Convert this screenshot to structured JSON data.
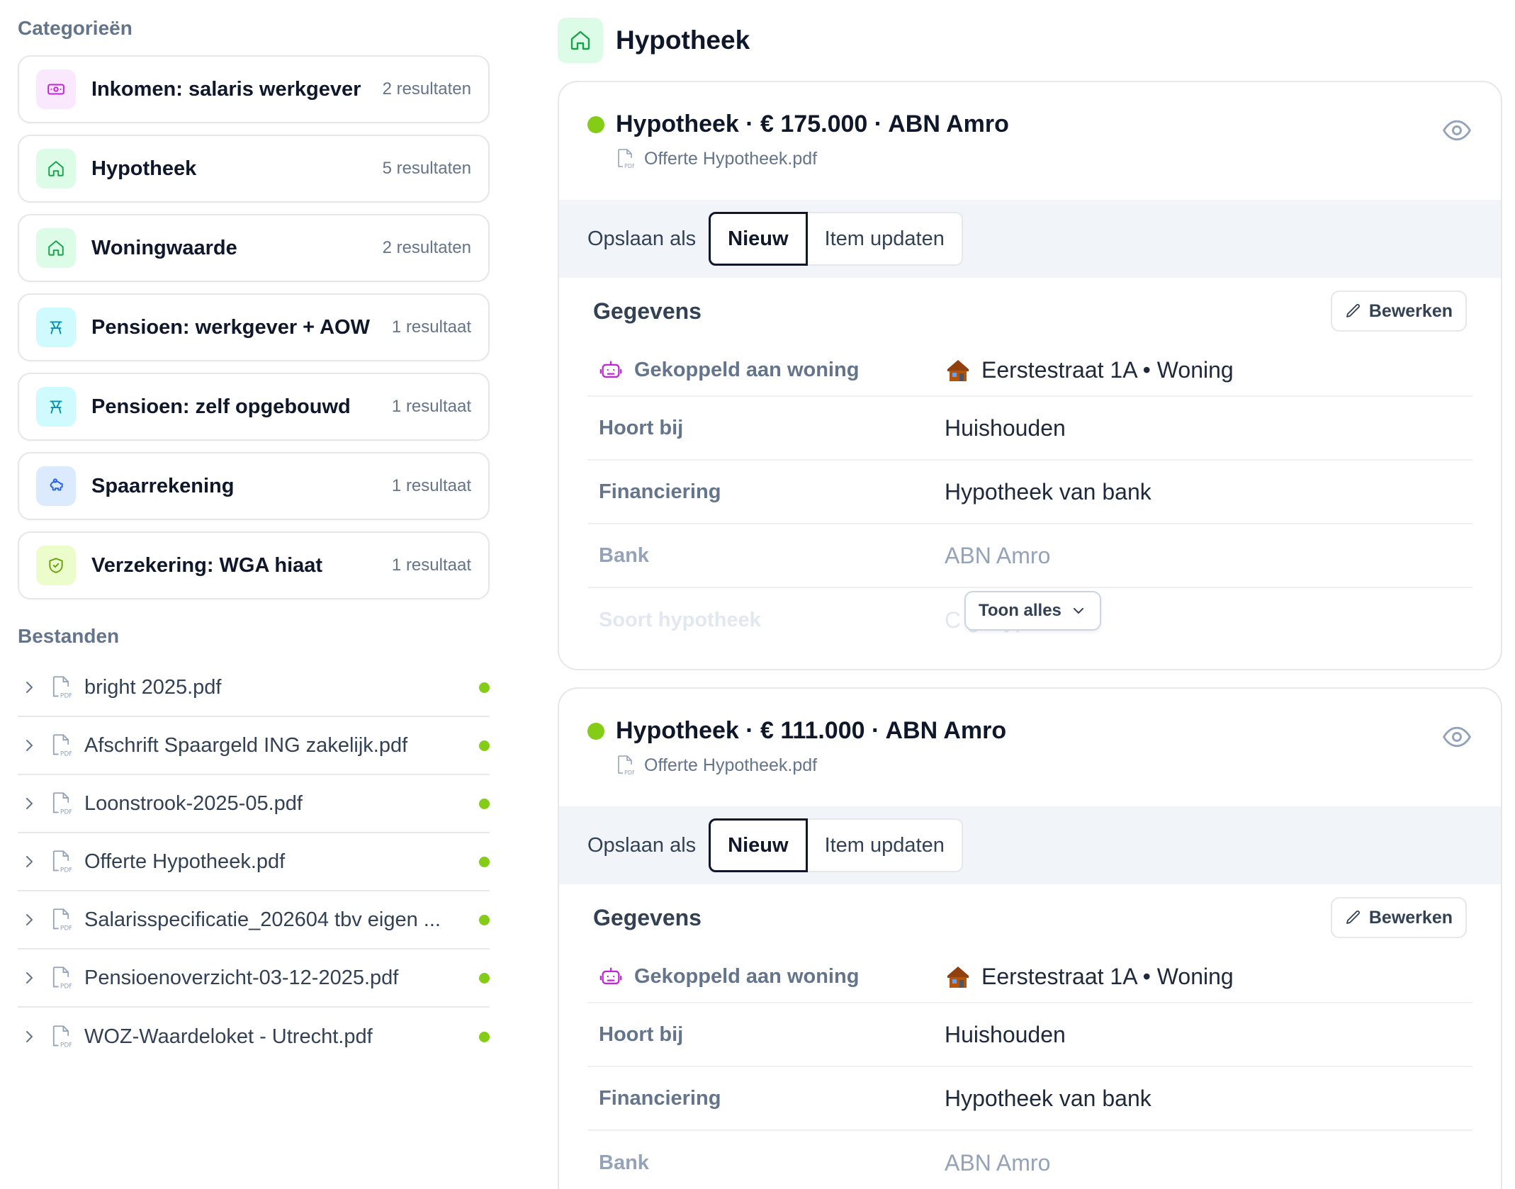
{
  "sidebar": {
    "categories_title": "Categorieën",
    "categories": [
      {
        "name": "Inkomen: salaris werkgever",
        "count": "2 resultaten",
        "icon": "banknote-icon",
        "bg": "#fae8ff",
        "fg": "#c026d3"
      },
      {
        "name": "Hypotheek",
        "count": "5 resultaten",
        "icon": "home-icon",
        "bg": "#dcfce7",
        "fg": "#16a34a"
      },
      {
        "name": "Woningwaarde",
        "count": "2 resultaten",
        "icon": "home-icon",
        "bg": "#dcfce7",
        "fg": "#16a34a"
      },
      {
        "name": "Pensioen: werkgever + AOW",
        "count": "1 resultaat",
        "icon": "beach-chair-icon",
        "bg": "#cffafe",
        "fg": "#0891b2"
      },
      {
        "name": "Pensioen: zelf opgebouwd",
        "count": "1 resultaat",
        "icon": "beach-chair-icon",
        "bg": "#cffafe",
        "fg": "#0891b2"
      },
      {
        "name": "Spaarrekening",
        "count": "1 resultaat",
        "icon": "piggy-bank-icon",
        "bg": "#dbeafe",
        "fg": "#2563eb"
      },
      {
        "name": "Verzekering: WGA hiaat",
        "count": "1 resultaat",
        "icon": "shield-check-icon",
        "bg": "#ecfccb",
        "fg": "#65a30d"
      }
    ],
    "files_title": "Bestanden",
    "files": [
      "bright 2025.pdf",
      "Afschrift Spaargeld ING zakelijk.pdf",
      "Loonstrook-2025-05.pdf",
      "Offerte Hypotheek.pdf",
      "Salarisspecificatie_202604 tbv eigen ...",
      "Pensioenoverzicht-03-12-2025.pdf",
      "WOZ-Waardeloket - Utrecht.pdf"
    ],
    "status_color": "#84cc16"
  },
  "main": {
    "title": "Hypotheek",
    "cards": [
      {
        "title": "Hypotheek · € 175.000 · ABN Amro",
        "file": "Offerte Hypotheek.pdf",
        "save_label": "Opslaan als",
        "seg_new": "Nieuw",
        "seg_update": "Item updaten",
        "details_title": "Gegevens",
        "edit_label": "Bewerken",
        "linked_label": "Gekoppeld aan woning",
        "linked_value": "Eerstestraat 1A • Woning",
        "rows": [
          {
            "label": "Hoort bij",
            "value": "Huishouden"
          },
          {
            "label": "Financiering",
            "value": "Hypotheek van bank"
          },
          {
            "label": "Bank",
            "value": "ABN Amro"
          },
          {
            "label": "Soort hypotheek",
            "value": "C gshypotheek"
          }
        ],
        "show_all": "Toon alles"
      },
      {
        "title": "Hypotheek · € 111.000 · ABN Amro",
        "file": "Offerte Hypotheek.pdf",
        "save_label": "Opslaan als",
        "seg_new": "Nieuw",
        "seg_update": "Item updaten",
        "details_title": "Gegevens",
        "edit_label": "Bewerken",
        "linked_label": "Gekoppeld aan woning",
        "linked_value": "Eerstestraat 1A • Woning",
        "rows": [
          {
            "label": "Hoort bij",
            "value": "Huishouden"
          },
          {
            "label": "Financiering",
            "value": "Hypotheek van bank"
          },
          {
            "label": "Bank",
            "value": "ABN Amro"
          }
        ]
      }
    ]
  }
}
